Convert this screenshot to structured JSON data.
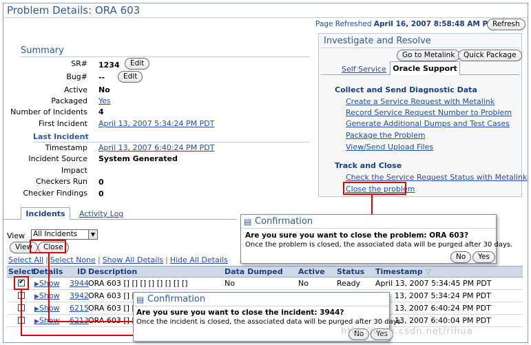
{
  "page": {
    "title": "Problem Details: ORA 603",
    "refreshed_label": "Page Refreshed",
    "refreshed_value": "April 16, 2007 8:58:48 AM PDT",
    "refresh_button": "Refresh"
  },
  "summary": {
    "heading": "Summary",
    "sr_label": "SR#",
    "sr_value": "1234",
    "sr_edit": "Edit",
    "bug_label": "Bug#",
    "bug_value": "--",
    "bug_edit": "Edit",
    "active_label": "Active",
    "active_value": "No",
    "packaged_label": "Packaged",
    "packaged_value": "Yes",
    "incidents_label": "Number of Incidents",
    "incidents_value": "4",
    "first_incident_label": "First Incident",
    "first_incident_value": "April 13, 2007 5:34:24 PM PDT"
  },
  "last_incident": {
    "heading": "Last Incident",
    "timestamp_label": "Timestamp",
    "timestamp_value": "April 13, 2007 6:40:24 PM PDT",
    "source_label": "Incident Source",
    "source_value": "System Generated",
    "impact_label": "Impact",
    "impact_value": "",
    "checkers_label": "Checkers Run",
    "checkers_value": "0",
    "findings_label": "Checker Findings",
    "findings_value": "0"
  },
  "investigate": {
    "title": "Investigate and Resolve",
    "metalink_button": "Go to Metalink",
    "quick_package_button": "Quick Package",
    "tab_self_service": "Self Service",
    "tab_oracle_support": "Oracle Support",
    "collect_heading": "Collect and Send Diagnostic Data",
    "collect_links": [
      "Create a Service Request with Metalink",
      "Record Service Request Number to Problem",
      "Generate Additional Dumps and Test Cases",
      "Package the Problem",
      "View/Send Upload Files"
    ],
    "track_heading": "Track and Close",
    "track_links": [
      "Check the Service Request Status with Metalink",
      "Close the problem"
    ]
  },
  "tabs": {
    "incidents": "Incidents",
    "activity_log": "Activity Log"
  },
  "view": {
    "label": "View",
    "selected": "All Incidents",
    "view_button": "View",
    "close_button": "Close"
  },
  "grid_links": {
    "select_all": "Select All",
    "select_none": "Select None",
    "show_all": "Show All Details",
    "hide_all": "Hide All Details"
  },
  "table": {
    "headers": {
      "select": "Select",
      "details": "Details",
      "id": "ID",
      "description": "Description",
      "data_dumped": "Data Dumped",
      "active": "Active",
      "status": "Status",
      "timestamp": "Timestamp"
    },
    "rows": [
      {
        "checked": true,
        "details": "Show",
        "id": "3944",
        "description": "ORA 603 [] [] [] [] [] [] [] []",
        "data_dumped": "No",
        "active": "No",
        "status": "Ready",
        "timestamp": "April 13, 2007 5:34:45 PM PDT"
      },
      {
        "checked": false,
        "details": "Show",
        "id": "3942",
        "description": "ORA 603 [] []",
        "data_dumped": "",
        "active": "",
        "status": "",
        "timestamp": "13, 2007 5:34:24 PM PDT"
      },
      {
        "checked": false,
        "details": "Show",
        "id": "6215",
        "description": "ORA 603 [] []",
        "data_dumped": "",
        "active": "",
        "status": "",
        "timestamp": "13, 2007 6:40:24 PM PDT"
      },
      {
        "checked": false,
        "details": "Show",
        "id": "6213",
        "description": "ORA 603 [] []",
        "data_dumped": "",
        "active": "",
        "status": "",
        "timestamp": "13, 2007 6:40:04 PM PDT"
      }
    ]
  },
  "dialog_problem": {
    "title": "Confirmation",
    "question": "Are you sure you want to close the problem: ORA 603?",
    "message": "Once the problem is closed, the associated data will be purged after 30 days.",
    "no": "No",
    "yes": "Yes"
  },
  "dialog_incident": {
    "title": "Confirmation",
    "question": "Are you sure you want to close the incident: 3944?",
    "message": "Once the incident is closed, the associated data will be purged after 30 days.",
    "no": "No",
    "yes": "Yes"
  },
  "watermark": "http://blog.csdn.net/rlhua",
  "colors": {
    "accent": "#2f5aa0",
    "link": "#1f4fa8",
    "highlight_red": "#e00000",
    "header_bg": "#d0d9e6"
  }
}
